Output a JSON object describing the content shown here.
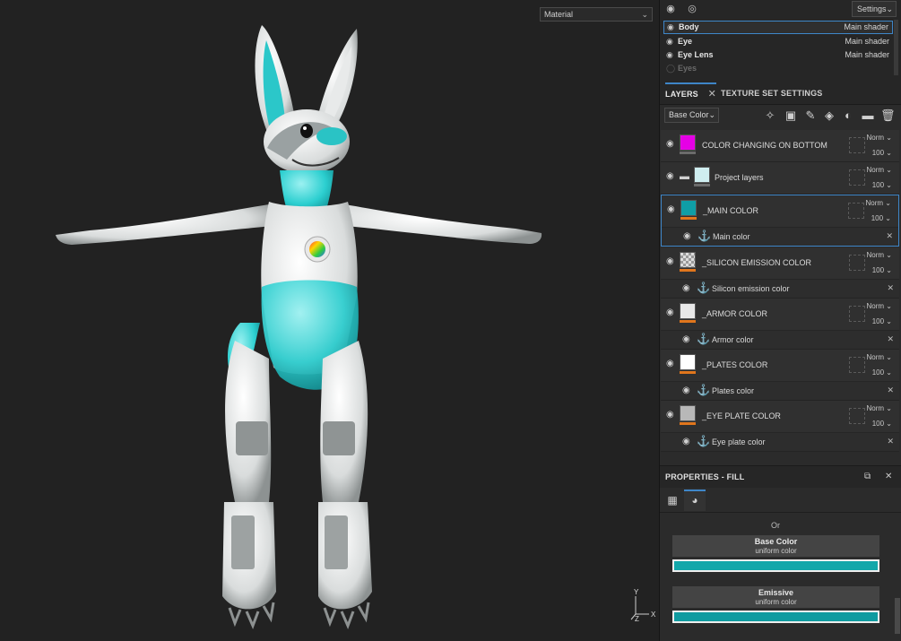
{
  "viewport": {
    "mode_select": "Material",
    "gizmo": {
      "y": "Y",
      "z": "Z",
      "x": "X"
    }
  },
  "texture_sets": {
    "settings_label": "Settings",
    "items": [
      {
        "name": "Body",
        "shader": "Main shader",
        "selected": true
      },
      {
        "name": "Eye",
        "shader": "Main shader"
      },
      {
        "name": "Eye Lens",
        "shader": "Main shader"
      },
      {
        "name": "Eyes",
        "shader": "",
        "disabled": true
      }
    ]
  },
  "tabs": {
    "layers": "LAYERS",
    "layers_close": "✕",
    "texture_set_settings": "TEXTURE SET SETTINGS"
  },
  "layer_toolbar": {
    "channel": "Base Color",
    "tools": [
      "magic-wand-icon",
      "mask-icon",
      "brush-icon",
      "fill-icon",
      "palette-icon",
      "folder-icon",
      "trash-icon"
    ]
  },
  "layers": [
    {
      "name": "COLOR CHANGING ON BOTTOM",
      "blend": "Norm",
      "opacity": "100",
      "thumb_color": "#e600e6",
      "bar": "grey"
    },
    {
      "name": "Project layers",
      "blend": "Norm",
      "opacity": "100",
      "folder": true,
      "bar": "grey"
    },
    {
      "name": "_MAIN COLOR",
      "blend": "Norm",
      "opacity": "100",
      "thumb_color": "#0f9ea6",
      "selected": true,
      "effect": "Main color"
    },
    {
      "name": "_SILICON EMISSION COLOR",
      "blend": "Norm",
      "opacity": "100",
      "checker": true,
      "effect": "Silicon emission color"
    },
    {
      "name": "_ARMOR COLOR",
      "blend": "Norm",
      "opacity": "100",
      "thumb_color": "#e8e8e8",
      "effect": "Armor color"
    },
    {
      "name": "_PLATES COLOR",
      "blend": "Norm",
      "opacity": "100",
      "thumb_color": "#ffffff",
      "effect": "Plates color"
    },
    {
      "name": "_EYE PLATE COLOR",
      "blend": "Norm",
      "opacity": "100",
      "thumb_color": "#b8b8b8",
      "effect": "Eye plate color"
    }
  ],
  "properties": {
    "title": "PROPERTIES - FILL",
    "or_label": "Or",
    "channels": [
      {
        "name": "Base Color",
        "type": "uniform color",
        "color": "#12a7aa"
      },
      {
        "name": "Emissive",
        "type": "uniform color",
        "color": "#0f9ba0"
      }
    ]
  },
  "colors": {
    "accent": "#3e86c8",
    "teal": "#22c4c8",
    "magenta": "#e600e6",
    "orange": "#e0761d"
  }
}
